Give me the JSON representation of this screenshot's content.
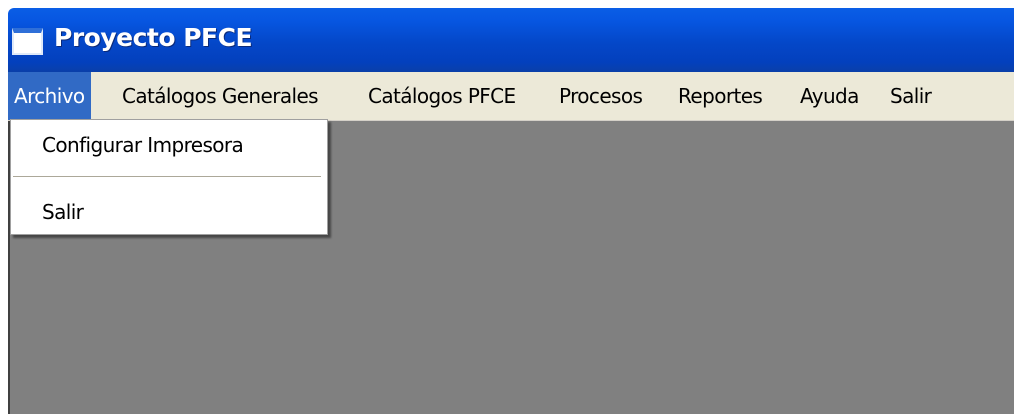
{
  "window": {
    "title": "Proyecto PFCE"
  },
  "menubar": {
    "items": [
      {
        "label": "Archivo",
        "active": true
      },
      {
        "label": "Catálogos Generales"
      },
      {
        "label": "Catálogos PFCE"
      },
      {
        "label": "Procesos"
      },
      {
        "label": "Reportes"
      },
      {
        "label": "Ayuda"
      },
      {
        "label": "Salir"
      }
    ]
  },
  "archivo_menu": {
    "items": [
      {
        "label": "Configurar Impresora"
      },
      {
        "label": "Salir"
      }
    ]
  },
  "colors": {
    "titlebar": "#0447c8",
    "menubar": "#ece9d8",
    "menu_highlight": "#316ac5",
    "client_area": "#808080"
  },
  "icons": {
    "app": "window-app-icon"
  }
}
